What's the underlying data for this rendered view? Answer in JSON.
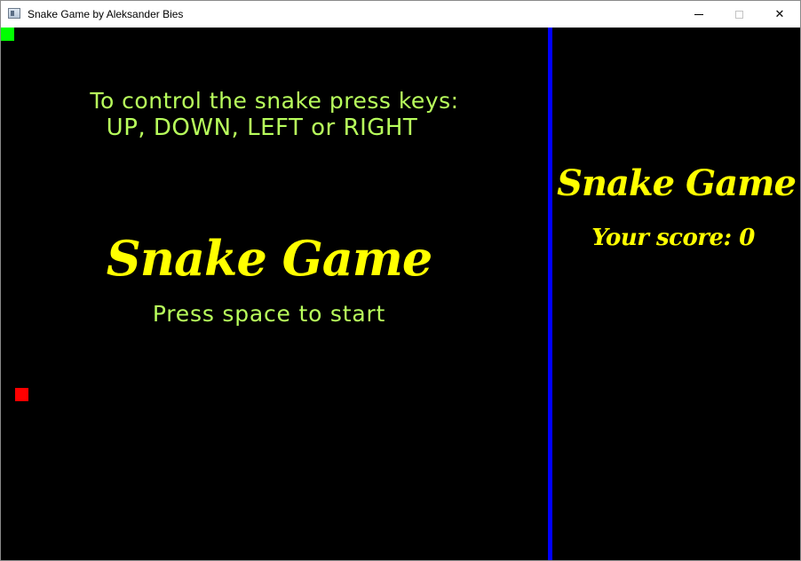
{
  "window": {
    "title": "Snake Game by Aleksander Bies",
    "buttons": {
      "minimize": "minimize",
      "maximize": "maximize",
      "close": "✕"
    }
  },
  "game": {
    "controls_line1": "To control the snake press keys:",
    "controls_line2": "UP, DOWN, LEFT or RIGHT",
    "main_title": "Snake Game",
    "start_prompt": "Press space to start"
  },
  "sidebar": {
    "title": "Snake Game",
    "score_label": "Your score: ",
    "score_value": "0"
  },
  "colors": {
    "background": "#000000",
    "snake": "#00ff00",
    "food": "#ff0000",
    "divider": "#0000ff",
    "title_text": "#ffff00",
    "info_text": "#b8ff5c"
  }
}
